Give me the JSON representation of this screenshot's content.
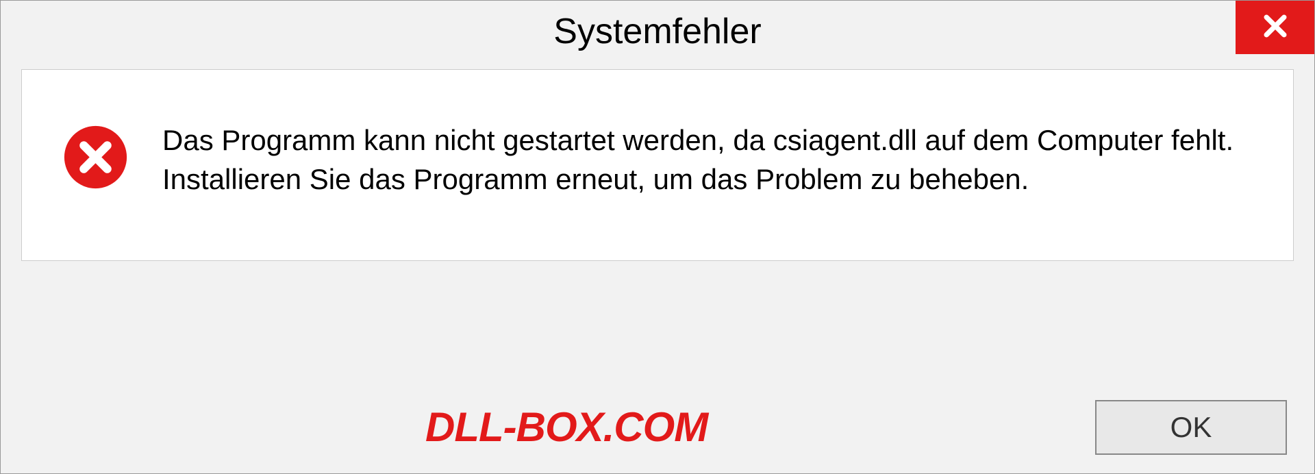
{
  "dialog": {
    "title": "Systemfehler",
    "message": "Das Programm kann nicht gestartet werden, da csiagent.dll auf dem Computer fehlt. Installieren Sie das Programm erneut, um das Problem zu beheben.",
    "ok_label": "OK"
  },
  "watermark": "DLL-BOX.COM",
  "colors": {
    "error_red": "#e21a1a",
    "background": "#f2f2f2"
  }
}
